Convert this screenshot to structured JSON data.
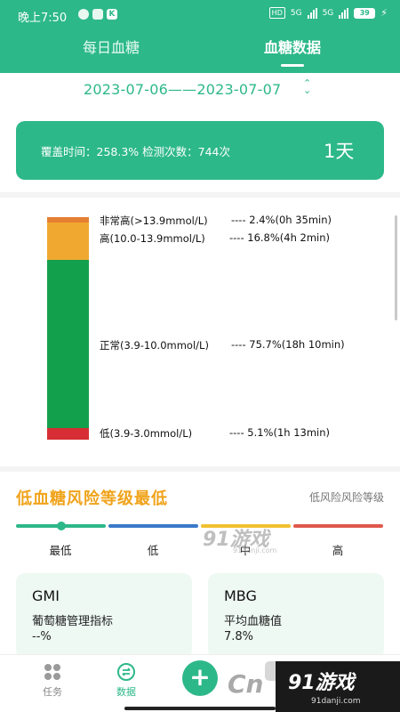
{
  "status_bar": {
    "time": "晚上7:50",
    "hd": "HD",
    "network1": "5G",
    "network2": "5G",
    "battery": "39"
  },
  "tabs": {
    "daily": "每日血糖",
    "data": "血糖数据"
  },
  "date_range": {
    "text": "2023-07-06——2023-07-07",
    "arrow": "⌃⌄"
  },
  "summary": {
    "coverage_text": "覆盖时间：258.3% 检测次数：744次",
    "days": "1天"
  },
  "distribution": {
    "rows": [
      {
        "label": "非常高(>13.9mmol/L)",
        "value": "----  2.4%(0h 35min)",
        "percent": 2.4,
        "color": "#e57f32"
      },
      {
        "label": "高(10.0-13.9mmol/L)",
        "value": "----  16.8%(4h 2min)",
        "percent": 16.8,
        "color": "#f0a830"
      },
      {
        "label": "正常(3.9-10.0mmol/L)",
        "value": "----  75.7%(18h 10min)",
        "percent": 75.7,
        "color": "#12a04d"
      },
      {
        "label": "低(3.9-3.0mmol/L)",
        "value": "----  5.1%(1h 13min)",
        "percent": 5.1,
        "color": "#d62e34"
      }
    ]
  },
  "risk": {
    "title": "低血糖风险等级最低",
    "subtitle": "低风险风险等级",
    "levels": [
      "最低",
      "低",
      "中",
      "高"
    ],
    "current_level": "最低"
  },
  "metrics": {
    "gmi": {
      "title": "GMI",
      "desc": "葡萄糖管理指标",
      "value": "--%"
    },
    "mbg": {
      "title": "MBG",
      "desc": "平均血糖值",
      "value": "7.8%"
    }
  },
  "nav": {
    "tasks": "任务",
    "data": "数据",
    "add": "+"
  },
  "watermark": {
    "text": "91游戏",
    "site": "91danji.com",
    "fragment": "Cn"
  },
  "colors": {
    "brand": "#2db88a",
    "risk_title": "#f0a31a"
  }
}
